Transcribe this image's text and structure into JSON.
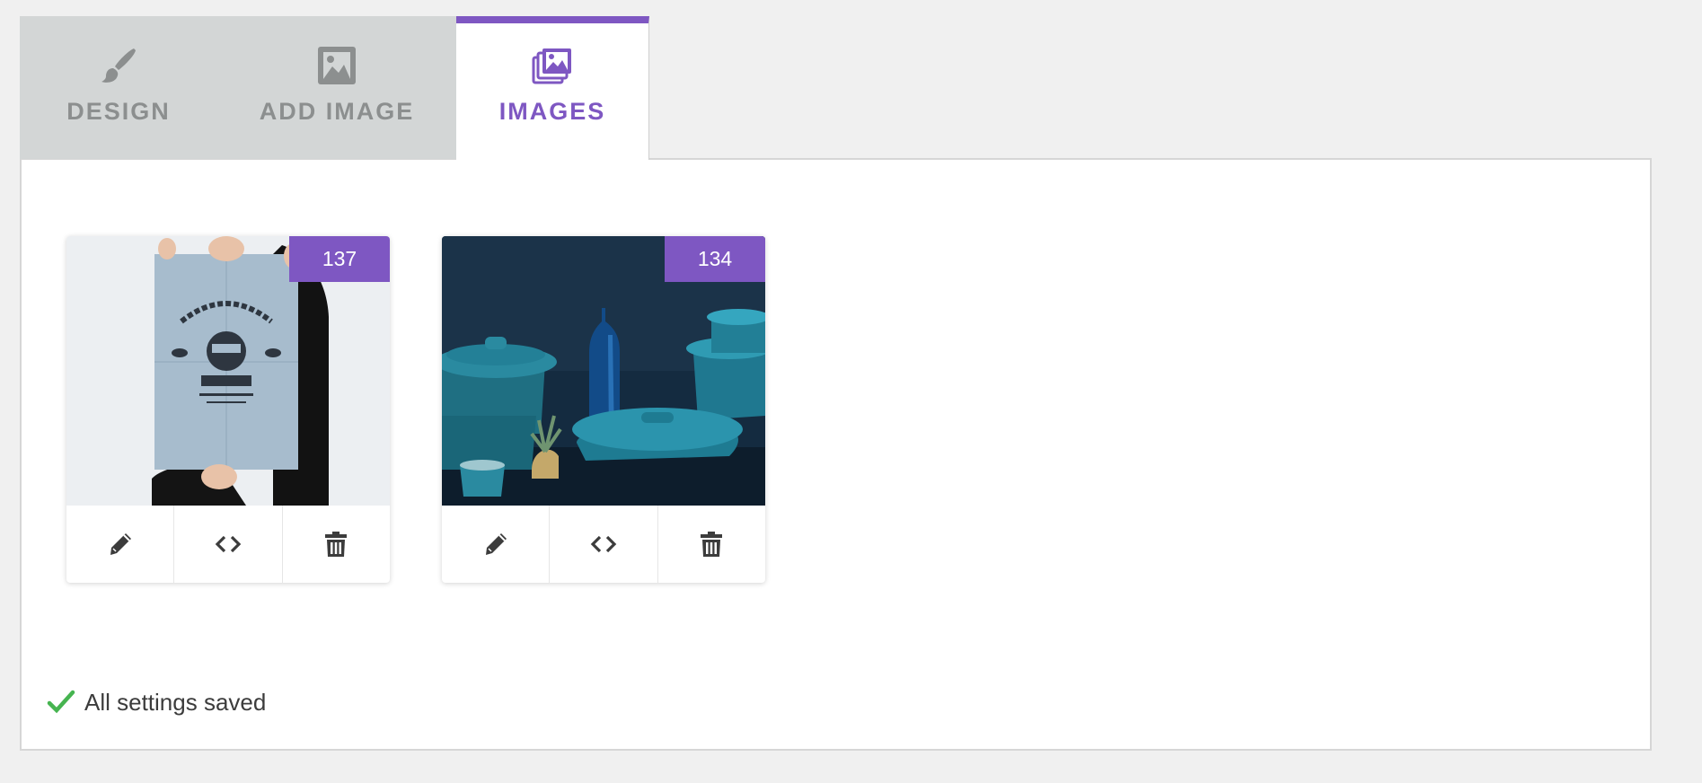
{
  "tabs": [
    {
      "label": "DESIGN",
      "icon": "paintbrush-icon",
      "active": false
    },
    {
      "label": "ADD IMAGE",
      "icon": "image-icon",
      "active": false
    },
    {
      "label": "IMAGES",
      "icon": "image-stack-icon",
      "active": true
    }
  ],
  "images": [
    {
      "id": "137",
      "thumbnail": "poster-woothemes"
    },
    {
      "id": "134",
      "thumbnail": "teal-cookware"
    }
  ],
  "status": {
    "text": "All settings saved",
    "icon": "checkmark-icon"
  },
  "colors": {
    "accent": "#7e57c2",
    "tab_inactive_bg": "#d3d6d6",
    "tab_inactive_text": "#8c8f8f",
    "success": "#46b450",
    "page_bg": "#f0f0f0"
  }
}
